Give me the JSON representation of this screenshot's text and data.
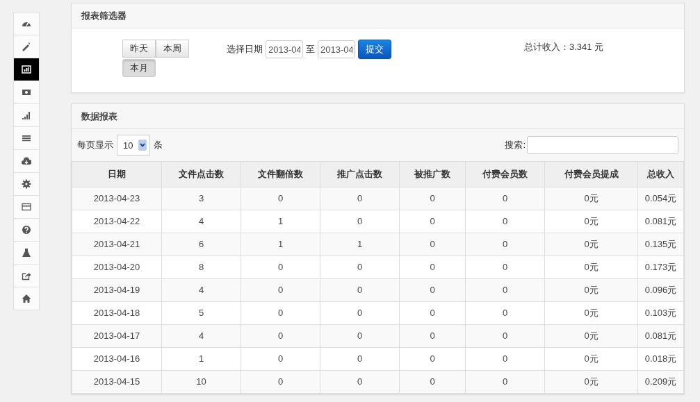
{
  "sidebar": {
    "items": [
      {
        "selected": false
      },
      {
        "selected": false
      },
      {
        "selected": true
      },
      {
        "selected": false
      },
      {
        "selected": false
      },
      {
        "selected": false
      },
      {
        "selected": false
      },
      {
        "selected": false
      },
      {
        "selected": false
      },
      {
        "selected": false
      },
      {
        "selected": false
      },
      {
        "selected": false
      },
      {
        "selected": false
      }
    ]
  },
  "filter_panel": {
    "title": "报表筛选器",
    "range_buttons": [
      {
        "label": "昨天",
        "selected": false
      },
      {
        "label": "本周",
        "selected": false
      },
      {
        "label": "本月",
        "selected": true
      }
    ],
    "date_label": "选择日期",
    "start_date": "2013-04",
    "separator": "至",
    "end_date": "2013-04",
    "submit": "提交",
    "total": "总计收入：3.341 元"
  },
  "report_panel": {
    "title": "数据报表",
    "page_size_label": "每页显示",
    "page_size": "10",
    "page_size_unit": "条",
    "search_label": "搜索:",
    "table": {
      "columns": [
        "日期",
        "文件点击数",
        "文件翻倍数",
        "推广点击数",
        "被推广数",
        "付费会员数",
        "付费会员提成",
        "总收入"
      ],
      "rows": [
        [
          "2013-04-23",
          "3",
          "0",
          "0",
          "0",
          "0",
          "0元",
          "0.054元"
        ],
        [
          "2013-04-22",
          "4",
          "1",
          "0",
          "0",
          "0",
          "0元",
          "0.081元"
        ],
        [
          "2013-04-21",
          "6",
          "1",
          "1",
          "0",
          "0",
          "0元",
          "0.135元"
        ],
        [
          "2013-04-20",
          "8",
          "0",
          "0",
          "0",
          "0",
          "0元",
          "0.173元"
        ],
        [
          "2013-04-19",
          "4",
          "0",
          "0",
          "0",
          "0",
          "0元",
          "0.096元"
        ],
        [
          "2013-04-18",
          "5",
          "0",
          "0",
          "0",
          "0",
          "0元",
          "0.103元"
        ],
        [
          "2013-04-17",
          "4",
          "0",
          "0",
          "0",
          "0",
          "0元",
          "0.081元"
        ],
        [
          "2013-04-16",
          "1",
          "0",
          "0",
          "0",
          "0",
          "0元",
          "0.018元"
        ],
        [
          "2013-04-15",
          "10",
          "0",
          "0",
          "0",
          "0",
          "0元",
          "0.209元"
        ]
      ]
    }
  }
}
